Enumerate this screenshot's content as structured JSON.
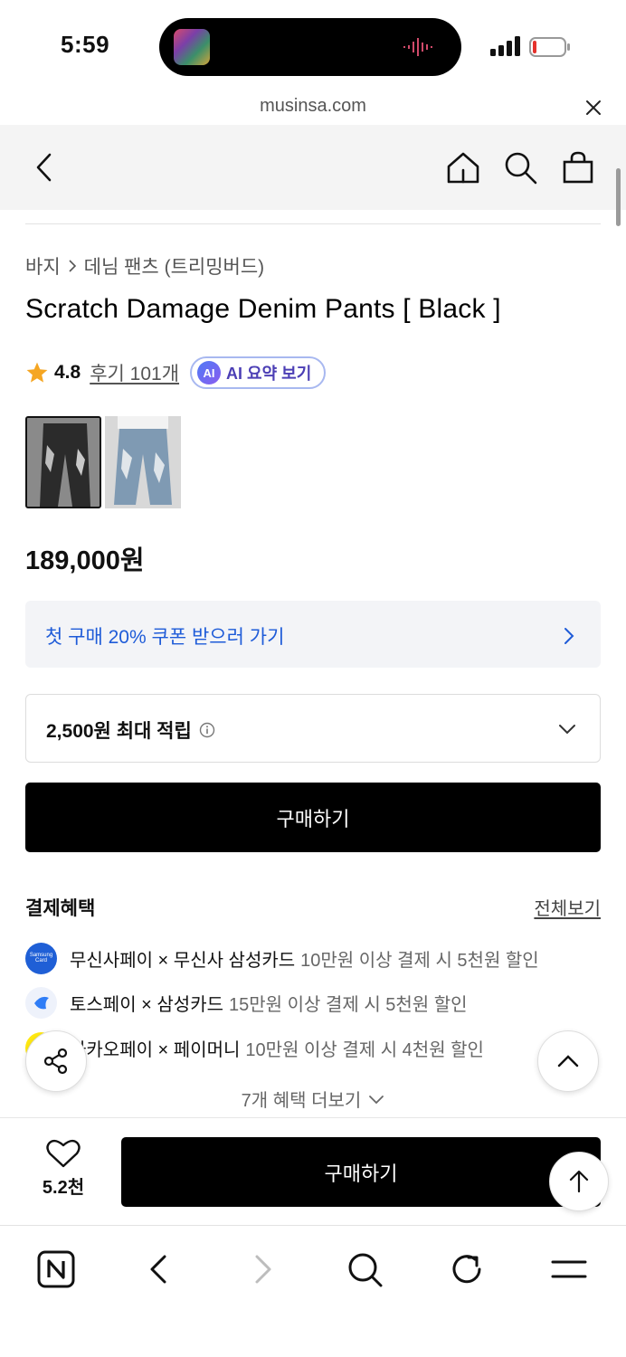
{
  "status_bar": {
    "time": "5:59"
  },
  "browser": {
    "url": "musinsa.com"
  },
  "nav": {
    "back_icon": "chevron-left-icon",
    "home_icon": "home-icon",
    "search_icon": "search-icon",
    "cart_icon": "shopping-bag-icon"
  },
  "product": {
    "breadcrumb": [
      "바지",
      "데님 팬츠 (트리밍버드)"
    ],
    "title": "Scratch Damage Denim Pants [ Black ]",
    "rating": "4.8",
    "review_link": "후기 101개",
    "ai_badge": "AI",
    "ai_summary_label": "AI 요약 보기",
    "price": "189,000원"
  },
  "coupon": {
    "label": "첫 구매 20% 쿠폰 받으러 가기"
  },
  "points": {
    "label": "2,500원 최대 적립"
  },
  "buy_label": "구매하기",
  "benefits": {
    "title": "결제혜택",
    "view_all": "전체보기",
    "items": [
      {
        "icon_text": "Samsung Card",
        "strong": "무신사페이 × 무신사 삼성카드",
        "light": "10만원 이상 결제 시 5천원 할인"
      },
      {
        "strong": "토스페이 × 삼성카드",
        "light": "15만원 이상 결제 시 5천원 할인"
      },
      {
        "strong": "카카오페이 × 페이머니",
        "light": "10만원 이상 결제 시 4천원 할인"
      }
    ],
    "more": "7개 혜택 더보기"
  },
  "bottom": {
    "wish_count": "5.2천",
    "buy_label": "구매하기"
  },
  "colors": {
    "accent_blue": "#1e5bd8",
    "primary_button": "#000000",
    "nav_bg": "#f4f4f4"
  }
}
